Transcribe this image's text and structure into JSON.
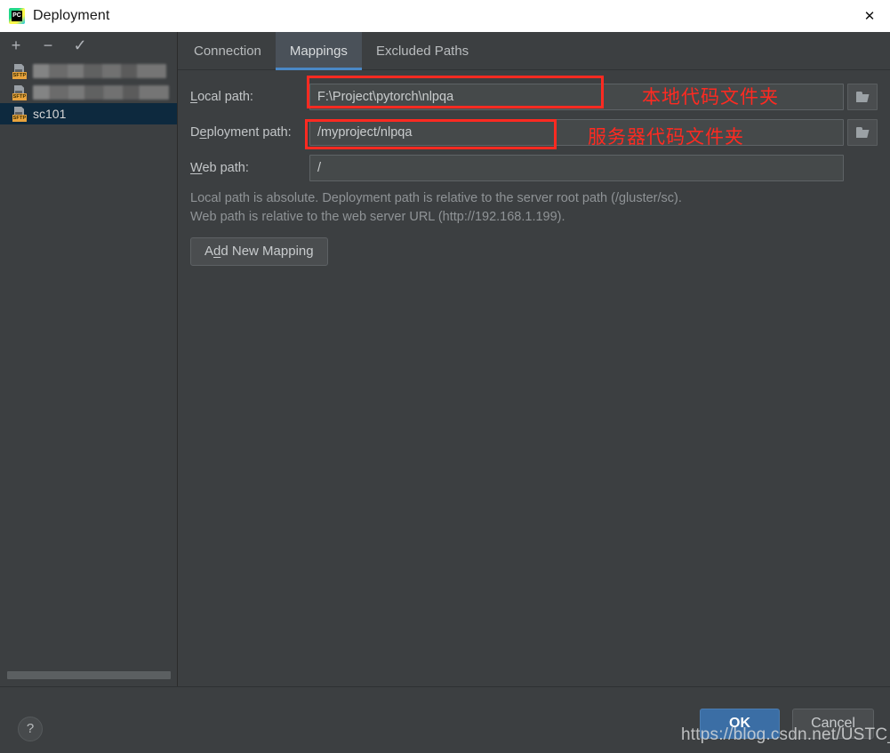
{
  "window": {
    "title": "Deployment",
    "icon": "pycharm-icon",
    "close_label": "✕"
  },
  "sidebar": {
    "toolbar": [
      {
        "name": "add-server-button",
        "glyph": "+"
      },
      {
        "name": "remove-server-button",
        "glyph": "−"
      },
      {
        "name": "set-default-server-button",
        "glyph": "✓"
      }
    ],
    "server_type_tag": "SFTP",
    "items": [
      {
        "label": "",
        "redacted": true,
        "selected": false
      },
      {
        "label": "",
        "redacted": true,
        "selected": false
      },
      {
        "label": "sc101",
        "redacted": false,
        "selected": true
      }
    ]
  },
  "tabs": [
    {
      "label": "Connection",
      "active": false
    },
    {
      "label": "Mappings",
      "active": true
    },
    {
      "label": "Excluded Paths",
      "active": false
    }
  ],
  "mappings": {
    "local_path": {
      "label_pre": "",
      "label_mnemonic": "L",
      "label_post": "ocal path:",
      "value": "F:\\Project\\pytorch\\nlpqa",
      "browse_icon": "folder-icon",
      "annotation": "本地代码文件夹"
    },
    "deployment_path": {
      "label_pre": "D",
      "label_mnemonic": "e",
      "label_post": "ployment path:",
      "value": "/myproject/nlpqa",
      "browse_icon": "folder-icon",
      "annotation": "服务器代码文件夹"
    },
    "web_path": {
      "label_pre": "",
      "label_mnemonic": "W",
      "label_post": "eb path:",
      "value": "/"
    },
    "hint_line_1": "Local path is absolute. Deployment path is relative to the server root path (/gluster/sc).",
    "hint_line_2": "Web path is relative to the web server URL (http://192.168.1.199).",
    "add_mapping": {
      "pre": "A",
      "mnemonic": "d",
      "post": "d New Mapping"
    }
  },
  "footer": {
    "help_label": "?",
    "ok_label": "OK",
    "cancel_label": "Cancel"
  },
  "watermark": "https://blog.csdn.net/USTC_SC",
  "colors": {
    "dialog_bg": "#3c3f41",
    "titlebar_bg": "#ffffff",
    "tab_active_bg": "#4a5159",
    "tab_accent": "#4a88c7",
    "selection_bg": "#0d293e",
    "annotation_red": "#ff2a21",
    "ok_button_blue": "#3b6ea5",
    "field_bg": "#45494a",
    "sftp_tag": "#e8a33d"
  }
}
